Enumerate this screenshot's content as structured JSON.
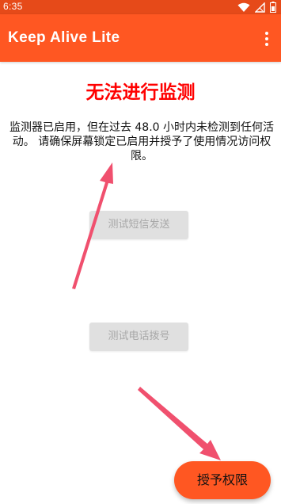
{
  "status_bar": {
    "time": "6:35",
    "icons": [
      "wifi-icon",
      "no-sim-icon",
      "battery-icon"
    ]
  },
  "app_bar": {
    "title": "Keep Alive Lite",
    "menu_icon": "more-vert-icon"
  },
  "content": {
    "headline": "无法进行监测",
    "message": "监测器已启用，但在过去 48.0 小时内未检测到任何活动。 请确保屏幕锁定已启用并授予了使用情况访问权限。",
    "test_sms_label": "测试短信发送",
    "test_call_label": "测试电话拨号"
  },
  "fab": {
    "label": "授予权限"
  },
  "colors": {
    "status_bar": "#e64a19",
    "app_bar": "#ff5722",
    "headline": "#ff0000",
    "annotation_arrow": "#f0506e"
  }
}
